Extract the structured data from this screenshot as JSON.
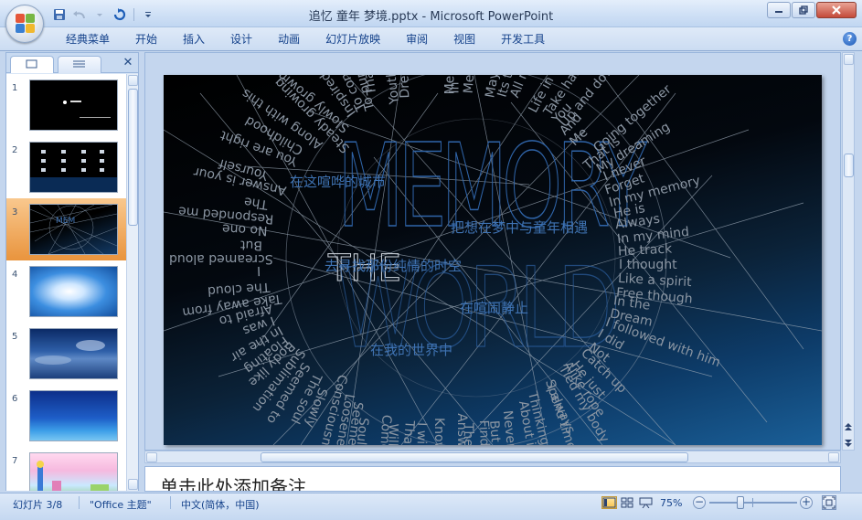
{
  "window": {
    "title": "追忆 童年 梦境.pptx - Microsoft PowerPoint",
    "minimize_icon": "minimize-icon",
    "maximize_icon": "restore-icon",
    "close_icon": "close-icon"
  },
  "quick_access": {
    "save_icon": "save-icon",
    "undo_icon": "undo-icon",
    "redo_icon": "redo-icon",
    "customize_icon": "customize-qat-icon"
  },
  "ribbon": {
    "tabs": [
      "经典菜单",
      "开始",
      "插入",
      "设计",
      "动画",
      "幻灯片放映",
      "审阅",
      "视图",
      "开发工具"
    ],
    "help_label": "?"
  },
  "left_pane": {
    "tab_slides_icon": "slides-tab-icon",
    "tab_outline_icon": "outline-tab-icon",
    "close_label": "✕",
    "thumbnails": [
      {
        "num": "1",
        "selected": false
      },
      {
        "num": "2",
        "selected": false
      },
      {
        "num": "3",
        "selected": true
      },
      {
        "num": "4",
        "selected": false
      },
      {
        "num": "5",
        "selected": false
      },
      {
        "num": "6",
        "selected": false
      },
      {
        "num": "7",
        "selected": false
      }
    ]
  },
  "slide": {
    "lines_cn": [
      "在这喧哗的城市",
      "把想在梦中与童年相遇",
      "去寻找那份纯情的时空",
      "在喧闹静止",
      "在我的世界中"
    ],
    "big_title": [
      "MEMORY",
      "THE",
      "WORLD"
    ],
    "spiral_right": [
      "Going together",
      "My dreaming",
      "I never",
      "Forget",
      "In my memory",
      "He is",
      "Always",
      "In my mind",
      "He track",
      "I thought",
      "Like a spirit",
      "Free though",
      "In the",
      "Dream",
      "I followed with him",
      "I did",
      "Not",
      "Catch up",
      "He just",
      "Alike rope",
      "Tied my body",
      "I always",
      "Spend time",
      "Thinking",
      "About it",
      "Never",
      "But",
      "Find",
      "The",
      "Answer",
      "Know",
      "I will",
      "That"
    ],
    "spiral_left": [
      "Slowly growing",
      "Inspired me",
      "To continue",
      "To pursue",
      "That",
      "Youthful",
      "Dream",
      "Childhood",
      "Along with this",
      "Steady growing",
      "You are right",
      "Yourself",
      "Answer is your",
      "The",
      "Responded me",
      "No one",
      "But",
      "Screamed aloud",
      "I",
      "The cloud",
      "Take away from",
      "Afraid to",
      "I was",
      "In the air",
      "Floating",
      "Body like",
      "Sublimation",
      "Seemed to",
      "The soul",
      "Slowly",
      "Consciousness",
      "Loosened",
      "Seemed",
      "Soul",
      "Come",
      "Will"
    ],
    "spiral_top": [
      "Meet",
      "In",
      "Me",
      "Maybe",
      "Its true",
      "All my",
      "Life in min",
      "Take hand",
      "Up and down",
      "You",
      "And",
      "Me",
      "That is"
    ]
  },
  "notes": {
    "placeholder": "单击此处添加备注"
  },
  "status": {
    "slide_info": "幻灯片 3/8",
    "theme": "\"Office 主题\"",
    "language": "中文(简体，中国)",
    "zoom": "75%",
    "zoom_value_percent": 75,
    "view_normal_icon": "normal-view-icon",
    "view_sorter_icon": "slide-sorter-icon",
    "view_show_icon": "slideshow-icon",
    "fit_icon": "fit-window-icon"
  },
  "colors": {
    "accent": "#15428b",
    "selected_thumb": "#e9943d",
    "slide_text": "#3f73b3",
    "spiral_text": "#7b8794"
  }
}
